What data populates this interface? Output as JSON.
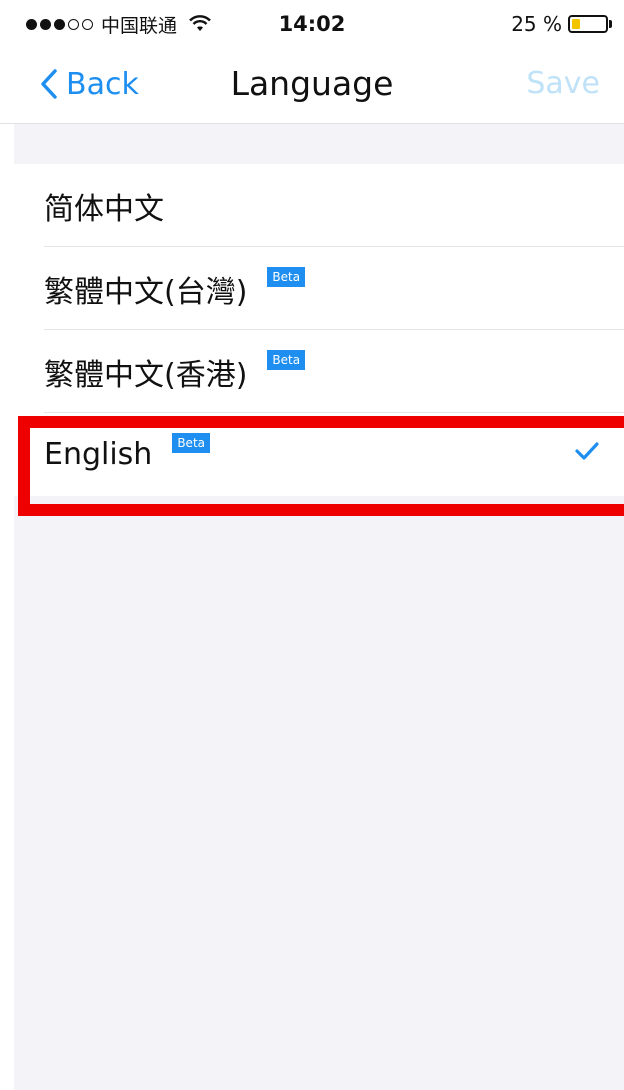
{
  "status_bar": {
    "carrier": "中国联通",
    "time": "14:02",
    "battery_percent": "25 %",
    "battery_level": 0.25,
    "battery_color": "#f2c500"
  },
  "nav": {
    "back_label": "Back",
    "title": "Language",
    "save_label": "Save",
    "accent_color": "#1e8ff0"
  },
  "languages": [
    {
      "label": "简体中文",
      "beta": false,
      "selected": false
    },
    {
      "label": "繁體中文(台灣)",
      "beta": true,
      "beta_label": "Beta",
      "selected": false
    },
    {
      "label": "繁體中文(香港)",
      "beta": true,
      "beta_label": "Beta",
      "selected": false
    },
    {
      "label": "English",
      "beta": true,
      "beta_label": "Beta",
      "selected": true,
      "highlight_color": "#ee0000"
    }
  ]
}
